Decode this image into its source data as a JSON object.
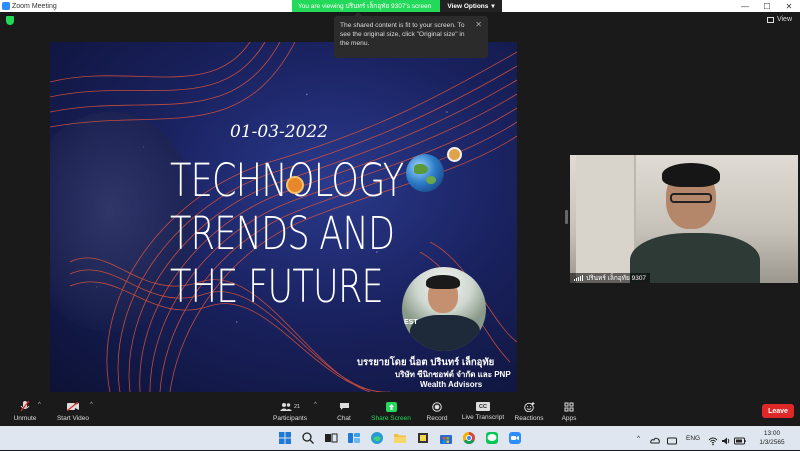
{
  "window": {
    "app_title": "Zoom Meeting",
    "controls": [
      "—",
      "☐",
      "✕"
    ]
  },
  "share_banner": {
    "viewing_text": "You are viewing ปรินทร์ เล็กอุทัย 9307's screen",
    "view_options_label": "View Options",
    "view_options_caret": "▾"
  },
  "top_right": {
    "view_label": "View"
  },
  "tooltip": {
    "text": "The shared content is fit to your screen. To see the original size, click \"Original size\" in the menu.",
    "close_glyph": "✕"
  },
  "slide": {
    "date": "01-03-2022",
    "title_line_1": "TECHNOLOGY",
    "title_line_2": "TRENDS AND",
    "title_line_3": "THE FUTURE",
    "photo_text": "EST",
    "credit_line_1": "บรรยายโดย   น็อต ปรินทร์ เล็กอุทัย",
    "credit_line_2": "บริษัท ซีนิกซอฟต์ จำกัด และ PNP",
    "credit_line_3": "Wealth Advisors"
  },
  "participant_video": {
    "name": "ปรินทร์ เล็กอุทัย 9307"
  },
  "toolbar": {
    "unmute_label": "Unmute",
    "start_video_label": "Start Video",
    "participants_label": "Participants",
    "participants_count": "21",
    "chat_label": "Chat",
    "share_screen_label": "Share Screen",
    "record_label": "Record",
    "live_transcript_label": "Live Transcript",
    "reactions_label": "Reactions",
    "apps_label": "Apps",
    "leave_label": "Leave",
    "cc_glyph": "CC",
    "caret_glyph": "^"
  },
  "taskbar": {
    "language": "ENG",
    "time": "13:00",
    "date": "1/3/2565",
    "tray_caret": "^"
  },
  "colors": {
    "zoom_green": "#23d959",
    "zoom_blue": "#2d8cff",
    "leave_red": "#e02828",
    "slide_lines": "#e2543a"
  }
}
